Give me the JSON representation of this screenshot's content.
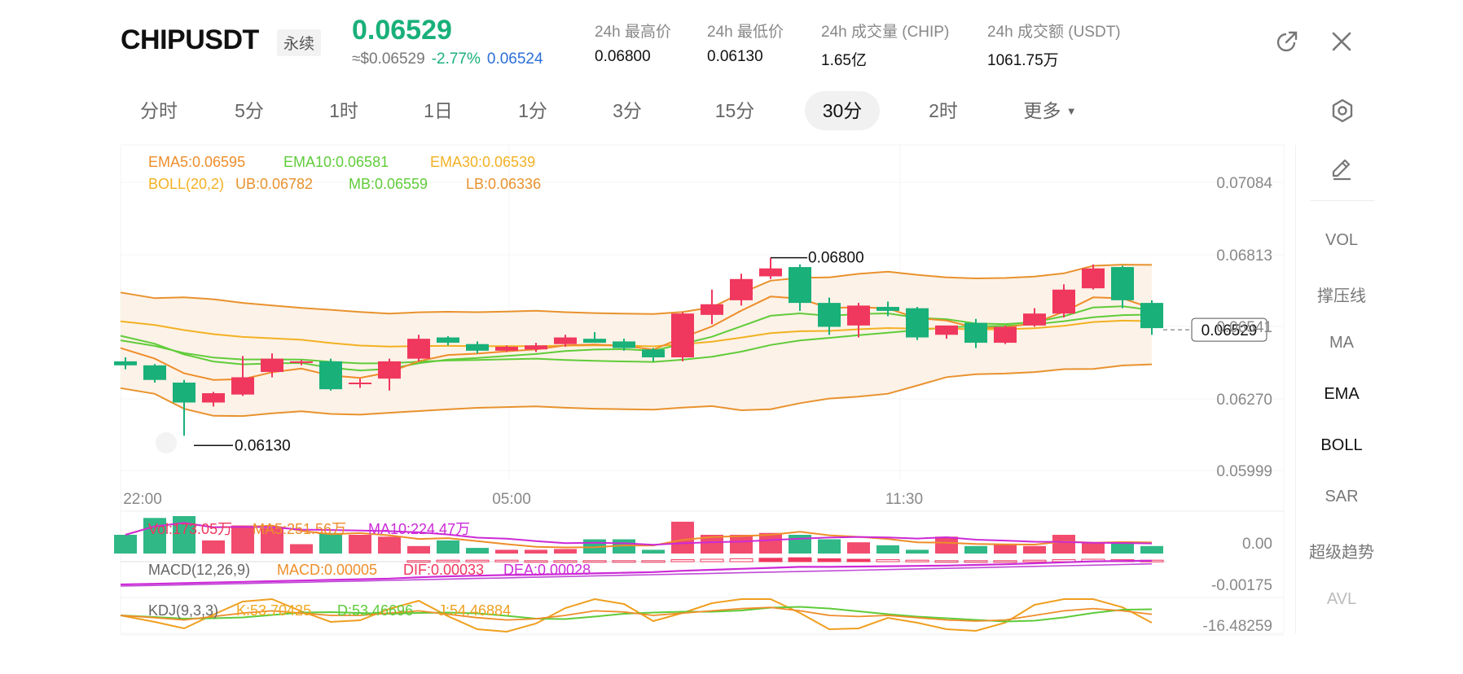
{
  "header": {
    "symbol": "CHIPUSDT",
    "badge": "永续",
    "last_price": "0.06529",
    "usd_price": "≈$0.06529",
    "change": "-2.77%",
    "mark_price": "0.06524",
    "stats": [
      {
        "label": "24h 最高价",
        "value": "0.06800"
      },
      {
        "label": "24h 最低价",
        "value": "0.06130"
      },
      {
        "label": "24h 成交量 (CHIP)",
        "value": "1.65亿"
      },
      {
        "label": "24h 成交额 (USDT)",
        "value": "1061.75万"
      }
    ],
    "icons": [
      "external-link-icon",
      "close-icon"
    ]
  },
  "timeframes": {
    "items": [
      "分时",
      "5分",
      "1时",
      "1日",
      "1分",
      "3分",
      "15分",
      "30分",
      "2时",
      "更多"
    ],
    "active": "30分",
    "settings_icon": "hexagon-settings-icon"
  },
  "right_panel": {
    "draw_icon": "pencil-icon",
    "items": [
      "VOL",
      "撑压线",
      "MA",
      "EMA",
      "BOLL",
      "SAR",
      "超级趋势",
      "AVL"
    ],
    "active": [
      "EMA",
      "BOLL"
    ]
  },
  "colors": {
    "up": "#19b07a",
    "down": "#f0375e",
    "ema5": "#ee8d2a",
    "ema10": "#60cc3a",
    "ema30": "#f2b123",
    "boll_band": "#e8922e",
    "boll_fill": "#fdf1e4",
    "macd_line": "#cc2ad6",
    "kdj_k": "#f0a81f",
    "kdj_d": "#5fcb3a",
    "kdj_j": "#ef9f1f"
  },
  "legend": {
    "ema5": "EMA5:0.06595",
    "ema10": "EMA10:0.06581",
    "ema30": "EMA30:0.06539",
    "boll": "BOLL(20,2)",
    "ub": "UB:0.06782",
    "mb": "MB:0.06559",
    "lb": "LB:0.06336",
    "vol": "Vol:173.05万",
    "ma5": "MA5:251.56万",
    "ma10": "MA10:224.47万",
    "macd_title": "MACD(12,26,9)",
    "macd": "MACD:0.00005",
    "dif": "DIF:0.00033",
    "dea": "DEA:0.00028",
    "kdj_title": "KDJ(9,3,3)",
    "k": "K:53.70425",
    "d": "D:53.46696",
    "j": "J:54.46884"
  },
  "chart_data": {
    "type": "candlestick",
    "interval": "30分",
    "x_tick_labels": [
      "22:00",
      "05:00",
      "11:30"
    ],
    "y_tick_labels": [
      "0.07084",
      "0.06813",
      "0.06541",
      "0.06270",
      "0.05999"
    ],
    "y_range": [
      0.05999,
      0.07084
    ],
    "current_price": "0.06529",
    "high_marker": "0.06800",
    "low_marker": "0.06130",
    "candles": [
      {
        "o": 0.0641,
        "h": 0.06425,
        "l": 0.0638,
        "c": 0.06395
      },
      {
        "o": 0.06395,
        "h": 0.064,
        "l": 0.0633,
        "c": 0.0634
      },
      {
        "o": 0.0633,
        "h": 0.0634,
        "l": 0.0613,
        "c": 0.06255
      },
      {
        "o": 0.06255,
        "h": 0.06295,
        "l": 0.0624,
        "c": 0.0629
      },
      {
        "o": 0.06285,
        "h": 0.0643,
        "l": 0.0628,
        "c": 0.0635
      },
      {
        "o": 0.0637,
        "h": 0.0644,
        "l": 0.0635,
        "c": 0.0642
      },
      {
        "o": 0.06405,
        "h": 0.06415,
        "l": 0.06395,
        "c": 0.0641
      },
      {
        "o": 0.0641,
        "h": 0.0642,
        "l": 0.063,
        "c": 0.06305
      },
      {
        "o": 0.06325,
        "h": 0.06345,
        "l": 0.0631,
        "c": 0.0633
      },
      {
        "o": 0.06345,
        "h": 0.0642,
        "l": 0.063,
        "c": 0.0641
      },
      {
        "o": 0.0642,
        "h": 0.0651,
        "l": 0.0641,
        "c": 0.06495
      },
      {
        "o": 0.065,
        "h": 0.06505,
        "l": 0.0647,
        "c": 0.0648
      },
      {
        "o": 0.06475,
        "h": 0.06485,
        "l": 0.0644,
        "c": 0.0645
      },
      {
        "o": 0.0645,
        "h": 0.0647,
        "l": 0.06445,
        "c": 0.06465
      },
      {
        "o": 0.06455,
        "h": 0.0648,
        "l": 0.06445,
        "c": 0.0647
      },
      {
        "o": 0.06475,
        "h": 0.0651,
        "l": 0.06465,
        "c": 0.065
      },
      {
        "o": 0.06495,
        "h": 0.0652,
        "l": 0.0648,
        "c": 0.0648
      },
      {
        "o": 0.06485,
        "h": 0.06495,
        "l": 0.0645,
        "c": 0.0646
      },
      {
        "o": 0.06455,
        "h": 0.0646,
        "l": 0.0641,
        "c": 0.06425
      },
      {
        "o": 0.06425,
        "h": 0.06595,
        "l": 0.0641,
        "c": 0.0659
      },
      {
        "o": 0.06585,
        "h": 0.0668,
        "l": 0.0655,
        "c": 0.06625
      },
      {
        "o": 0.0664,
        "h": 0.0674,
        "l": 0.0662,
        "c": 0.0672
      },
      {
        "o": 0.0673,
        "h": 0.068,
        "l": 0.0672,
        "c": 0.0676
      },
      {
        "o": 0.06765,
        "h": 0.06775,
        "l": 0.066,
        "c": 0.0663
      },
      {
        "o": 0.0663,
        "h": 0.0665,
        "l": 0.0651,
        "c": 0.0654
      },
      {
        "o": 0.06545,
        "h": 0.0663,
        "l": 0.065,
        "c": 0.0662
      },
      {
        "o": 0.06615,
        "h": 0.06635,
        "l": 0.0658,
        "c": 0.066
      },
      {
        "o": 0.0661,
        "h": 0.06615,
        "l": 0.0649,
        "c": 0.065
      },
      {
        "o": 0.0651,
        "h": 0.0654,
        "l": 0.06495,
        "c": 0.06545
      },
      {
        "o": 0.06555,
        "h": 0.0657,
        "l": 0.0646,
        "c": 0.0648
      },
      {
        "o": 0.0648,
        "h": 0.06545,
        "l": 0.06475,
        "c": 0.0654
      },
      {
        "o": 0.06545,
        "h": 0.0661,
        "l": 0.0654,
        "c": 0.0659
      },
      {
        "o": 0.0659,
        "h": 0.067,
        "l": 0.06575,
        "c": 0.0668
      },
      {
        "o": 0.06685,
        "h": 0.06775,
        "l": 0.0668,
        "c": 0.0676
      },
      {
        "o": 0.06765,
        "h": 0.0677,
        "l": 0.0661,
        "c": 0.0664
      },
      {
        "o": 0.0663,
        "h": 0.0664,
        "l": 0.0651,
        "c": 0.06535
      }
    ],
    "volume_axis_label": "0.00",
    "macd_axis_label": "-0.00175",
    "kdj_axis_label": "-16.48259"
  }
}
